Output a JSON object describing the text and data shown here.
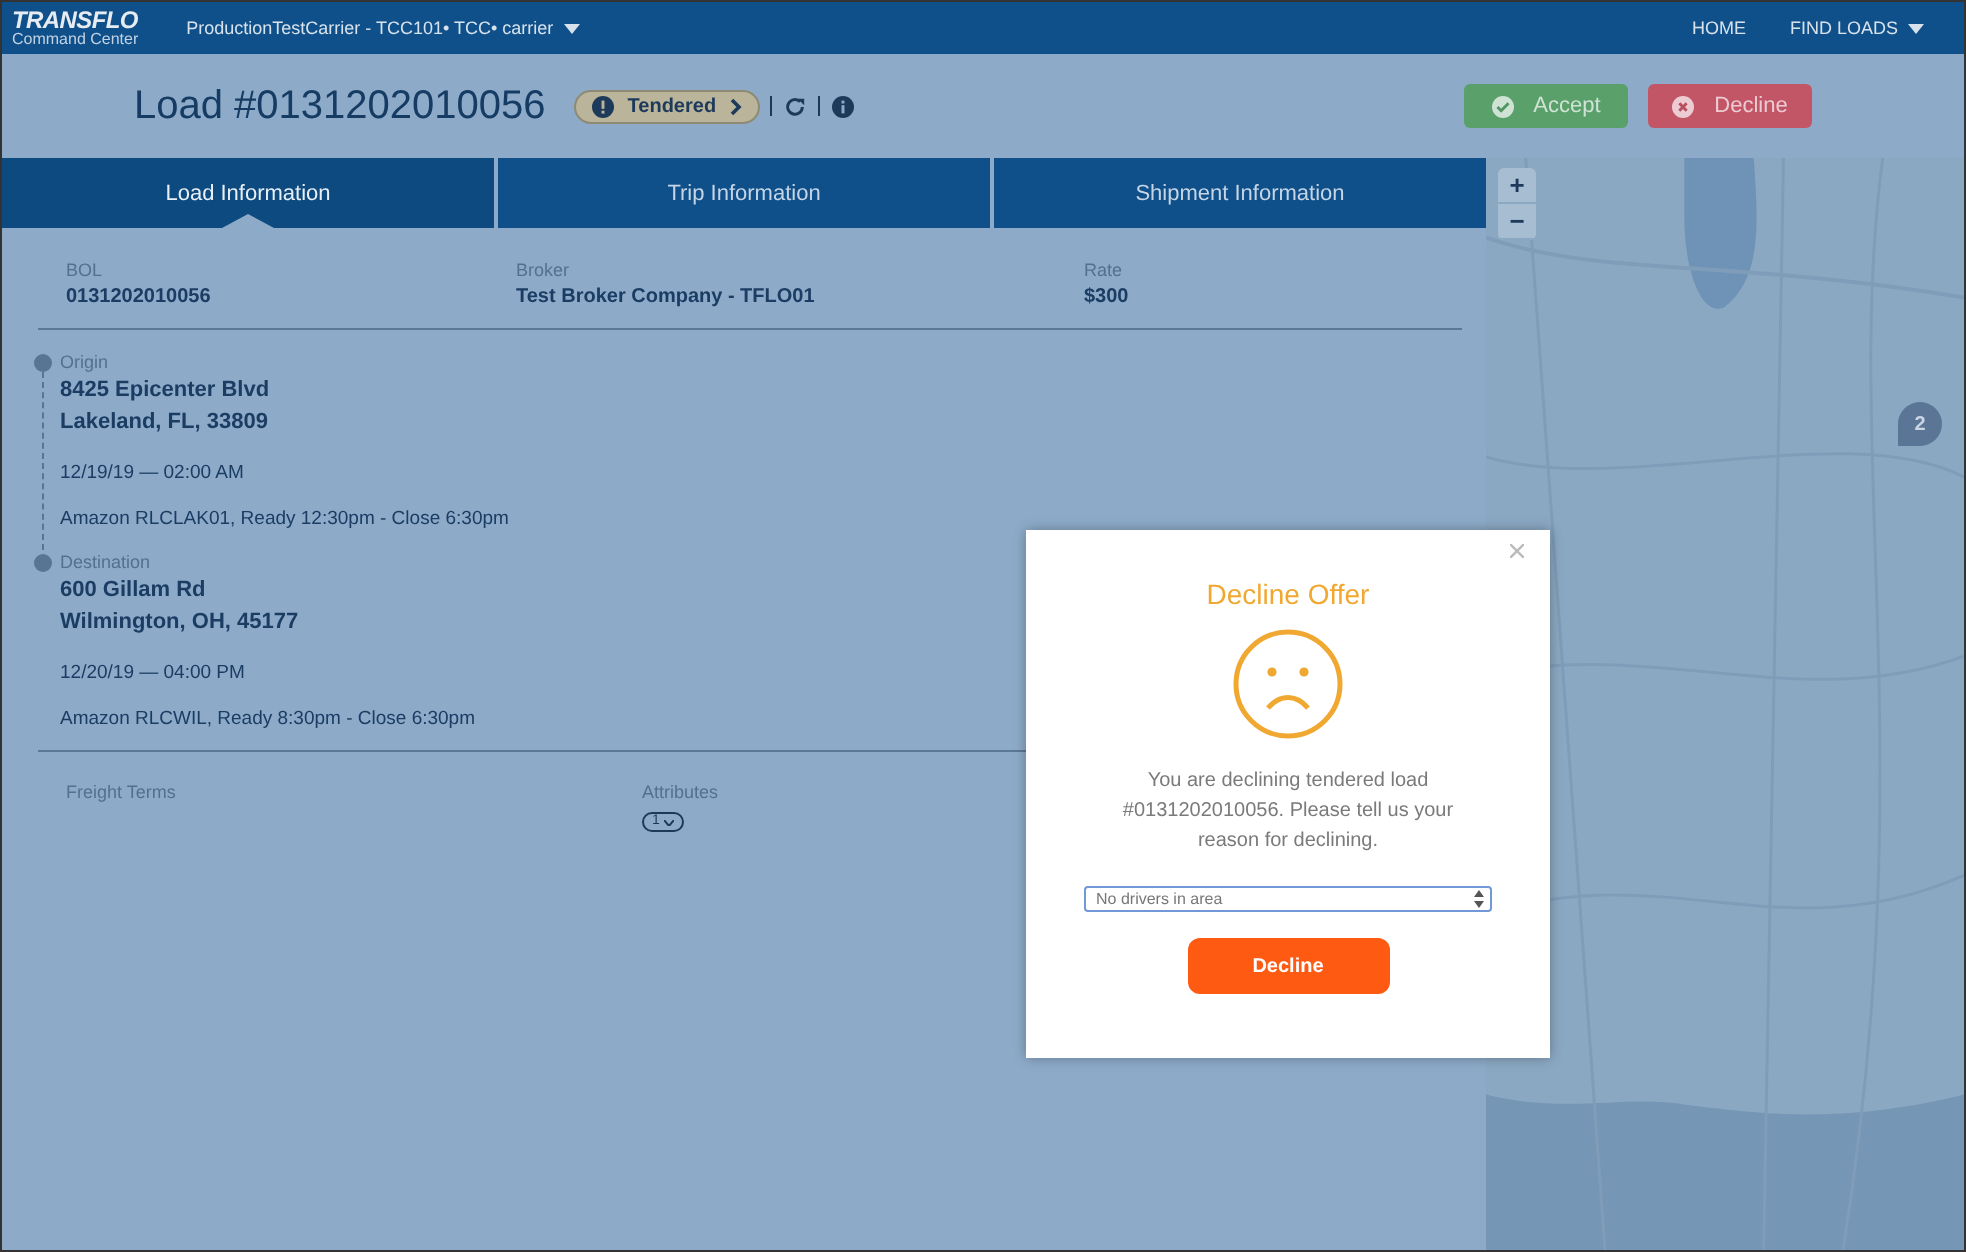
{
  "header": {
    "logo": {
      "title": "TRANSFLO",
      "subtitle": "Command Center"
    },
    "account": "ProductionTestCarrier - TCC101• TCC• carrier",
    "nav": [
      "HOME",
      "FIND LOADS"
    ]
  },
  "load": {
    "title": "Load #0131202010056",
    "status": "Tendered",
    "actions": [
      {
        "label": "Accept",
        "kind": "accept"
      },
      {
        "label": "Decline",
        "kind": "decline"
      }
    ]
  },
  "tabs": [
    {
      "label": "Load Information",
      "selected": true
    },
    {
      "label": "Trip Information",
      "selected": false
    },
    {
      "label": "Shipment Information",
      "selected": false
    }
  ],
  "summary": [
    {
      "label": "BOL",
      "value": "0131202010056"
    },
    {
      "label": "Broker",
      "value": "Test Broker Company - TFLO01"
    },
    {
      "label": "Rate",
      "value": "$300"
    }
  ],
  "stops": [
    {
      "label": "Origin",
      "address": [
        "8425 Epicenter Blvd",
        "Lakeland, FL, 33809"
      ],
      "datetime": "12/19/19 — 02:00 AM",
      "note": "Amazon RLCLAK01, Ready 12:30pm - Close 6:30pm"
    },
    {
      "label": "Destination",
      "address": [
        "600 Gillam Rd",
        "Wilmington, OH, 45177"
      ],
      "datetime": "12/20/19 — 04:00 PM",
      "note": "Amazon RLCWIL, Ready 8:30pm - Close 6:30pm"
    }
  ],
  "details": [
    {
      "label": "Freight Terms"
    },
    {
      "label": "Attributes",
      "badge": "1"
    }
  ],
  "map": {
    "controls": [
      "+",
      "−"
    ],
    "marker": "2"
  },
  "dialog": {
    "title": "Decline Offer",
    "message": "You are declining tendered load #0131202010056. Please tell us your reason for declining.",
    "reason": "No drivers in area",
    "button": "Decline"
  }
}
